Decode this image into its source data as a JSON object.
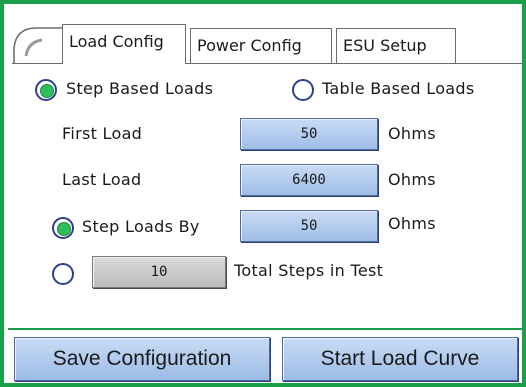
{
  "tabs": [
    {
      "label": "Load Config"
    },
    {
      "label": "Power Config"
    },
    {
      "label": "ESU Setup"
    }
  ],
  "load_mode": {
    "step_based_label": "Step Based Loads",
    "table_based_label": "Table Based Loads",
    "selected": "step_based"
  },
  "first_load": {
    "label": "First Load",
    "value": "50",
    "unit": "Ohms"
  },
  "last_load": {
    "label": "Last Load",
    "value": "6400",
    "unit": "Ohms"
  },
  "step_by": {
    "label": "Step Loads By",
    "value": "50",
    "unit": "Ohms",
    "selected": true
  },
  "total_steps": {
    "value": "10",
    "label": "Total Steps in Test",
    "selected": false
  },
  "buttons": {
    "save": "Save Configuration",
    "start": "Start Load Curve"
  },
  "colors": {
    "frame": "#1aa04a",
    "field": "#b3cdee",
    "radio_on": "#2fbf5a"
  },
  "icons": {
    "back": "back-arrow-icon"
  }
}
